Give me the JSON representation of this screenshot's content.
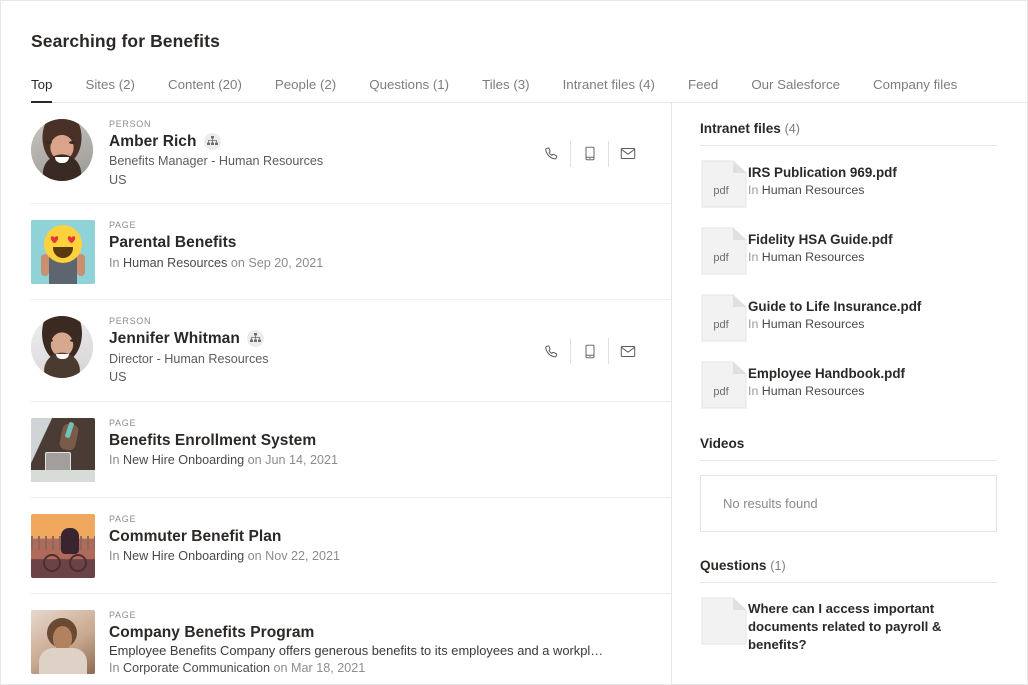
{
  "header": {
    "title": "Searching for Benefits"
  },
  "tabs": [
    {
      "label": "Top",
      "active": true
    },
    {
      "label": "Sites (2)",
      "active": false
    },
    {
      "label": "Content (20)",
      "active": false
    },
    {
      "label": "People (2)",
      "active": false
    },
    {
      "label": "Questions (1)",
      "active": false
    },
    {
      "label": "Tiles (3)",
      "active": false
    },
    {
      "label": "Intranet files (4)",
      "active": false
    },
    {
      "label": "Feed",
      "active": false
    },
    {
      "label": "Our Salesforce",
      "active": false
    },
    {
      "label": "Company files",
      "active": false
    }
  ],
  "results": [
    {
      "kicker": "PERSON",
      "title": "Amber Rich",
      "subtitle": "Benefits Manager - Human Resources",
      "location": "US",
      "has_orgchart": true,
      "contact_icons": [
        "phone-icon",
        "mobile-icon",
        "email-icon"
      ]
    },
    {
      "kicker": "PAGE",
      "title": "Parental Benefits",
      "in_label": "In",
      "site": "Human Resources",
      "on_label": "on",
      "date": "Sep 20, 2021"
    },
    {
      "kicker": "PERSON",
      "title": "Jennifer Whitman",
      "subtitle": "Director - Human Resources",
      "location": "US",
      "has_orgchart": true,
      "contact_icons": [
        "phone-icon",
        "mobile-icon",
        "email-icon"
      ]
    },
    {
      "kicker": "PAGE",
      "title": "Benefits Enrollment System",
      "in_label": "In",
      "site": "New Hire Onboarding",
      "on_label": "on",
      "date": "Jun 14, 2021"
    },
    {
      "kicker": "PAGE",
      "title": "Commuter Benefit Plan",
      "in_label": "In",
      "site": "New Hire Onboarding",
      "on_label": "on",
      "date": "Nov 22, 2021"
    },
    {
      "kicker": "PAGE",
      "title": "Company Benefits Program",
      "snippet": "Employee Benefits Company offers generous benefits to its employees and a workpl…",
      "in_label": "In",
      "site": "Corporate Communication",
      "on_label": "on",
      "date": "Mar 18, 2021"
    }
  ],
  "sidebar": {
    "intranet_files": {
      "heading": "Intranet files",
      "count": "(4)",
      "items": [
        {
          "name": "IRS Publication 969.pdf",
          "in_label": "In",
          "site": "Human Resources",
          "badge": "pdf"
        },
        {
          "name": "Fidelity HSA Guide.pdf",
          "in_label": "In",
          "site": "Human Resources",
          "badge": "pdf"
        },
        {
          "name": "Guide to Life Insurance.pdf",
          "in_label": "In",
          "site": "Human Resources",
          "badge": "pdf"
        },
        {
          "name": "Employee Handbook.pdf",
          "in_label": "In",
          "site": "Human Resources",
          "badge": "pdf"
        }
      ]
    },
    "videos": {
      "heading": "Videos",
      "empty_text": "No results found"
    },
    "questions": {
      "heading": "Questions",
      "count": "(1)",
      "items": [
        {
          "text": "Where can I access important documents related to payroll & benefits?"
        }
      ]
    }
  },
  "colors": {
    "text_primary": "#2b2826",
    "text_muted": "#7d7d7d",
    "rule": "#e6e6e6",
    "accent_underline": "#2b2826"
  }
}
